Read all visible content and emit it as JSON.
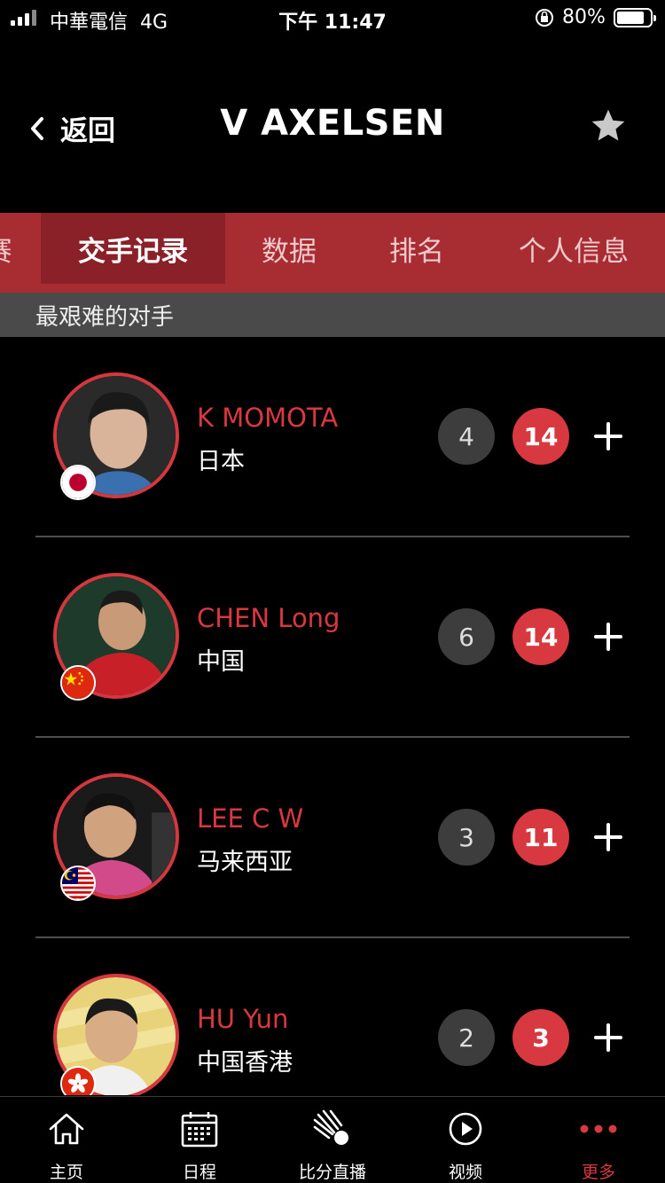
{
  "status_bar": {
    "carrier": "中華電信",
    "network": "4G",
    "time": "下午 11:47",
    "battery": "80%"
  },
  "nav": {
    "back_label": "返回",
    "title": "V AXELSEN"
  },
  "tabs": [
    {
      "label": "赛"
    },
    {
      "label": "交手记录"
    },
    {
      "label": "数据"
    },
    {
      "label": "排名"
    },
    {
      "label": "个人信息"
    }
  ],
  "section_title": "最艰难的对手",
  "opponents": [
    {
      "name": "K MOMOTA",
      "country": "日本",
      "wins": "4",
      "losses": "14",
      "flag": "japan"
    },
    {
      "name": "CHEN Long",
      "country": "中国",
      "wins": "6",
      "losses": "14",
      "flag": "china"
    },
    {
      "name": "LEE C W",
      "country": "马来西亚",
      "wins": "3",
      "losses": "11",
      "flag": "malaysia"
    },
    {
      "name": "HU Yun",
      "country": "中国香港",
      "wins": "2",
      "losses": "3",
      "flag": "hong-kong"
    }
  ],
  "bottom_nav": [
    {
      "label": "主页",
      "icon": "home-icon"
    },
    {
      "label": "日程",
      "icon": "calendar-icon"
    },
    {
      "label": "比分直播",
      "icon": "shuttlecock-icon"
    },
    {
      "label": "视频",
      "icon": "play-icon"
    },
    {
      "label": "更多",
      "icon": "more-icon"
    }
  ],
  "colors": {
    "accent": "#d8383f",
    "tab_bar": "#a82d33",
    "tab_active": "#8a2128",
    "section_bg": "#4a4a4a"
  }
}
